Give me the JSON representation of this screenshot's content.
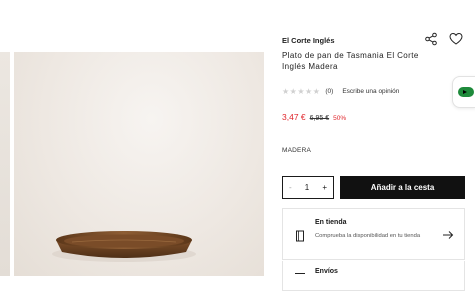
{
  "product": {
    "brand": "El Corte Inglés",
    "title": "Plato de pan de Tasmania El Corte Inglés Madera",
    "rating": {
      "stars": "★★★★★",
      "count": "(0)",
      "write_review": "Escribe una opinión"
    },
    "price": {
      "current": "3,47 €",
      "original": "6,95 €",
      "discount": "50%"
    },
    "material": "MADERA"
  },
  "purchase": {
    "quantity": "1",
    "minus": "-",
    "plus": "+",
    "add_to_cart": "Añadir a la cesta"
  },
  "store": {
    "title": "En tienda",
    "description": "Comprueba la disponibilidad en tu tienda"
  },
  "shipping": {
    "title": "Envíos"
  },
  "colors": {
    "price_red": "#e0252b",
    "button_black": "#111111",
    "tab_green": "#1e8a3b"
  },
  "icons": [
    "share-icon",
    "heart-icon",
    "store-icon",
    "arrow-right-icon",
    "play-tab-icon"
  ]
}
